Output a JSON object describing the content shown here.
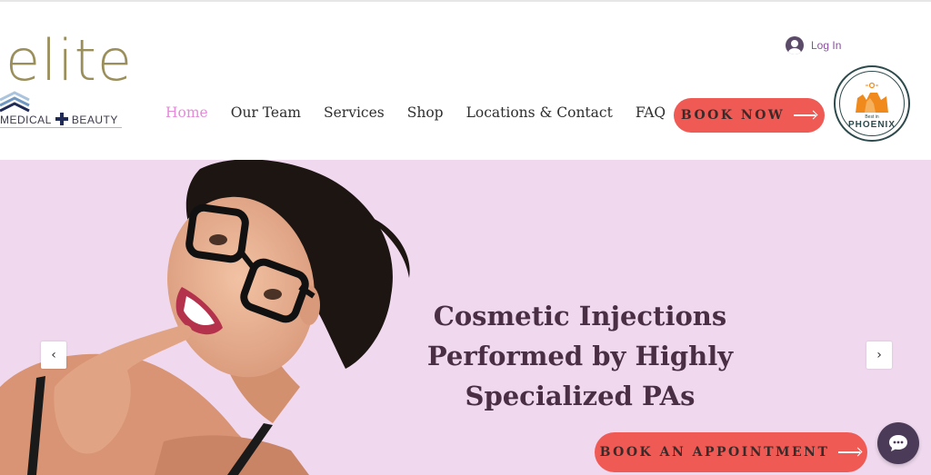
{
  "brand": {
    "logo_word": "elite",
    "logo_left": "MEDICAL",
    "logo_right": "BEAUTY",
    "colors": {
      "gold": "#9a8f5b",
      "navy": "#1f2a56"
    }
  },
  "header": {
    "login_label": "Log In",
    "nav": [
      {
        "label": "Home",
        "active": true
      },
      {
        "label": "Our Team"
      },
      {
        "label": "Services"
      },
      {
        "label": "Shop"
      },
      {
        "label": "Locations & Contact"
      },
      {
        "label": "FAQ"
      }
    ],
    "book_now_label": "BOOK NOW",
    "badge": {
      "small": "Best in",
      "city": "PHOENIX"
    }
  },
  "hero": {
    "title_lines": [
      "Cosmetic Injections",
      "Performed by Highly",
      "Specialized PAs"
    ],
    "cta_label": "BOOK AN APPOINTMENT",
    "prev_icon": "‹",
    "next_icon": "›",
    "background": "#f0d9ef"
  },
  "colors": {
    "accent": "#ef5a55",
    "active_nav": "#e58ad9",
    "chat_bg": "#4b3b58"
  },
  "icons": [
    "user-avatar-icon",
    "arrow-right-icon",
    "chevron-left-icon",
    "chevron-right-icon",
    "chat-bubble-icon"
  ]
}
